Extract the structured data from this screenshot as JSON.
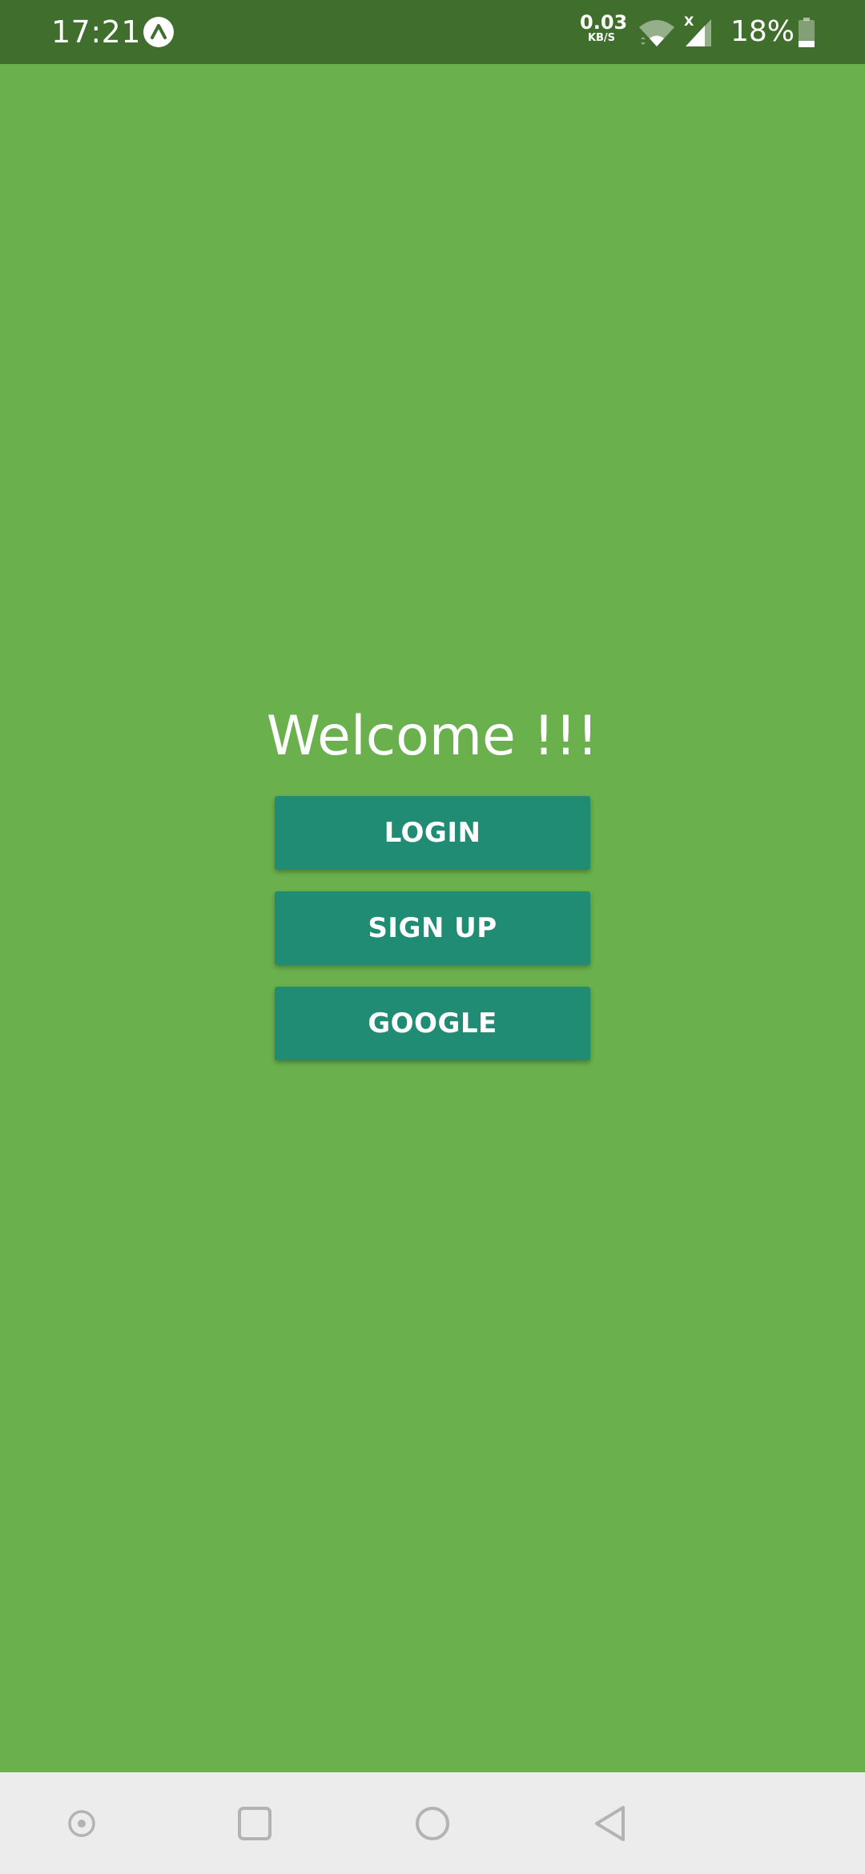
{
  "status_bar": {
    "time": "17:21",
    "app_icon": "expo-arrow-icon",
    "net_speed_value": "0.03",
    "net_speed_unit": "KB/S",
    "wifi_icon": "wifi-icon",
    "signal_icon": "cell-signal-icon",
    "signal_badge": "X",
    "battery_percent": "18%",
    "battery_icon": "battery-icon",
    "background_color": "#3f6e2d"
  },
  "main": {
    "title": "Welcome !!!",
    "background_color": "#6ab04c",
    "buttons": [
      {
        "label": "LOGIN"
      },
      {
        "label": "SIGN UP"
      },
      {
        "label": "GOOGLE"
      }
    ],
    "button_color": "#218c74"
  },
  "nav_bar": {
    "icons": [
      "assistant-dot-icon",
      "recents-square-icon",
      "home-circle-icon",
      "back-triangle-icon"
    ],
    "background_color": "#ececec"
  }
}
